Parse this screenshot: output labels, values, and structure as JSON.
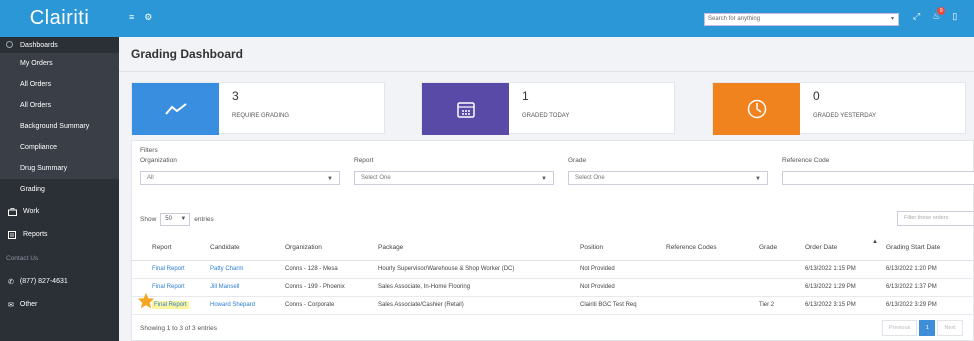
{
  "app": {
    "logo": "Clairiti"
  },
  "sidebar": {
    "top": "Dashboards",
    "sub_items": [
      {
        "label": "My Orders"
      },
      {
        "label": "All Orders"
      },
      {
        "label": "All Orders"
      },
      {
        "label": "Background Summary"
      },
      {
        "label": "Compliance"
      },
      {
        "label": "Drug Summary"
      },
      {
        "label": "Grading"
      }
    ],
    "work": "Work",
    "reports": "Reports",
    "contact": "Contact Us",
    "phone": "(877) 827-4631",
    "other": "Other"
  },
  "topbar": {
    "search_placeholder": "Search for anything",
    "notification_count": "9"
  },
  "page": {
    "title": "Grading Dashboard"
  },
  "cards": [
    {
      "count": "3",
      "label": "REQUIRE GRADING",
      "color": "#3a8ee0"
    },
    {
      "count": "1",
      "label": "GRADED TODAY",
      "color": "#5a4aa8"
    },
    {
      "count": "0",
      "label": "GRADED YESTERDAY",
      "color": "#f0831e"
    }
  ],
  "filters": {
    "title": "Filters",
    "organization": {
      "label": "Organization",
      "value": "All"
    },
    "report": {
      "label": "Report",
      "value": "Select One"
    },
    "grade": {
      "label": "Grade",
      "value": "Select One"
    },
    "reference_code": {
      "label": "Reference Code",
      "value": ""
    }
  },
  "table": {
    "show_label": "Show",
    "entries_value": "50",
    "entries_label": "entries",
    "filter_placeholder": "Filter these orders",
    "columns": [
      "Report",
      "Candidate",
      "Organization",
      "Package",
      "Position",
      "Reference Codes",
      "Grade",
      "Order Date",
      "Grading Start Date"
    ],
    "rows": [
      {
        "report": "Final Report",
        "candidate": "Patty Charm",
        "organization": "Conns - 128 - Mesa",
        "package": "Hourly Supervisor/Warehouse & Shop Worker (DC)",
        "position": "Not Provided",
        "reference_codes": "",
        "grade": "",
        "order_date": "6/13/2022 1:15 PM",
        "grading_start": "6/13/2022 1:20 PM"
      },
      {
        "report": "Final Report",
        "candidate": "Jill Mansell",
        "organization": "Conns - 199 - Phoenix",
        "package": "Sales Associate, In-Home Flooring",
        "position": "Not Provided",
        "reference_codes": "",
        "grade": "",
        "order_date": "6/13/2022 1:29 PM",
        "grading_start": "6/13/2022 1:37 PM"
      },
      {
        "report": "Final Report",
        "candidate": "Howard Shepard",
        "organization": "Conns - Corporate",
        "package": "Sales Associate/Cashier (Retail)",
        "position": "Clairiti BGC Test Req",
        "reference_codes": "",
        "grade": "Tier 2",
        "order_date": "6/13/2022 3:15 PM",
        "grading_start": "6/13/2022 3:29 PM"
      }
    ],
    "info": "Showing 1 to 3 of 3 entries",
    "pager": {
      "previous": "Previous",
      "current": "1",
      "next": "Next"
    }
  }
}
